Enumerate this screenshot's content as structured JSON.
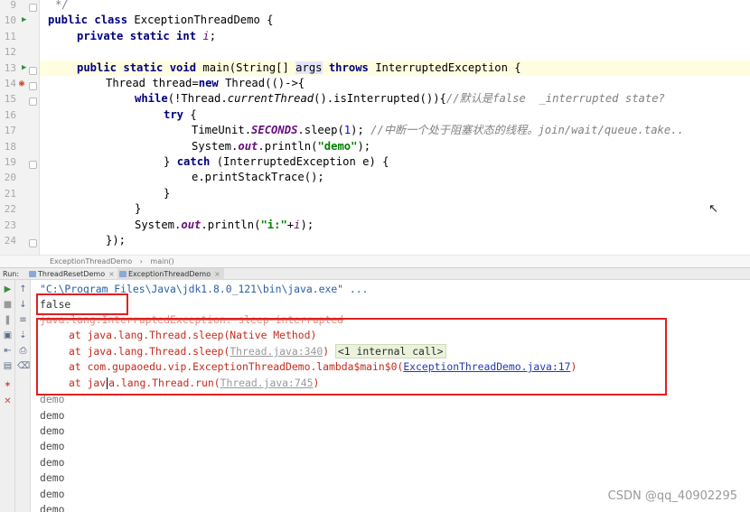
{
  "editor": {
    "line_numbers": [
      "9",
      "10",
      "11",
      "12",
      "13",
      "14",
      "15",
      "16",
      "17",
      "18",
      "19",
      "20",
      "21",
      "22",
      "23",
      "24"
    ],
    "lines": {
      "l9": "*/",
      "l10_kw": "public class",
      "l10_name": " ExceptionThreadDemo {",
      "l11_kw": "private static int",
      "l11_fld": "i",
      "l11_end": ";",
      "l13_kw": "public static void",
      "l13_main": " main(String[] ",
      "l13_args": "args",
      "l13_throws": "throws",
      "l13_exc": " InterruptedException {",
      "l14_a": "Thread thread=",
      "l14_new": "new",
      "l14_b": " Thread(()->{",
      "l15_kw": "while",
      "l15_a": "(!Thread.",
      "l15_mi": "currentThread",
      "l15_b": "().isInterrupted()){",
      "l15_cmt": "//默认是false  _interrupted state?",
      "l16_kw": "try",
      "l16_b": " {",
      "l17_a": "TimeUnit.",
      "l17_sf": "SECONDS",
      "l17_b": ".sleep(",
      "l17_num": "1",
      "l17_c": "); ",
      "l17_cmt": "//中断一个处于阻塞状态的线程。join/wait/queue.take..",
      "l18_a": "System.",
      "l18_fld": "out",
      "l18_b": ".println(",
      "l18_str": "\"demo\"",
      "l18_c": ");",
      "l19_a": "} ",
      "l19_kw": "catch",
      "l19_b": " (InterruptedException e) {",
      "l20": "e.printStackTrace();",
      "l21": "}",
      "l22": "}",
      "l23_a": "System.",
      "l23_fld": "out",
      "l23_b": ".println(",
      "l23_str": "\"i:\"",
      "l23_c": "+",
      "l23_fld2": "i",
      "l23_d": ");",
      "l24": "});"
    }
  },
  "breadcrumbs": [
    "ExceptionThreadDemo",
    "main()"
  ],
  "run_panel": {
    "label": "Run:",
    "tabs": [
      {
        "label": "ThreadResetDemo",
        "close": "×"
      },
      {
        "label": "ExceptionThreadDemo",
        "close": "×"
      }
    ]
  },
  "console": {
    "cmd": "\"C:\\Program Files\\Java\\jdk1.8.0_121\\bin\\java.exe\" ...",
    "false_line": "false",
    "exception": "java.lang.InterruptedException: sleep interrupted",
    "st1": "at java.lang.Thread.sleep(Native Method)",
    "st2_a": "at java.lang.Thread.sleep(",
    "st2_link": "Thread.java:340",
    "st2_b": ") ",
    "st2_icall": "<1 internal call>",
    "st3_a": "at com.gupaoedu.vip.ExceptionThreadDemo.lambda$main$0(",
    "st3_link": "ExceptionThreadDemo.java:17",
    "st3_b": ")",
    "st4_a": "at jav",
    "st4_b": "a.lang.Thread.run(",
    "st4_link": "Thread.java:745",
    "st4_c": ")",
    "demo_lines": [
      "demo",
      "demo",
      "demo",
      "demo",
      "demo",
      "demo",
      "demo",
      "demo"
    ]
  },
  "watermark": "CSDN @qq_40902295",
  "colors": {
    "annotation_box": "#e02020",
    "keyword": "#000080",
    "string": "#008000"
  }
}
